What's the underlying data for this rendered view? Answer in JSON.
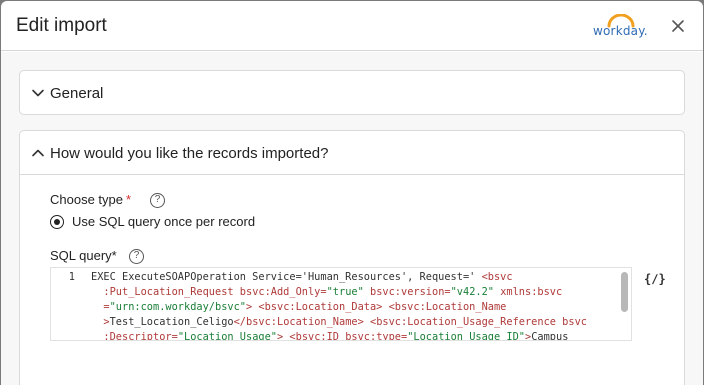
{
  "dialog": {
    "title": "Edit import",
    "logo_text": "workday.",
    "close_icon": "close-icon"
  },
  "sections": {
    "general": {
      "title": "General",
      "expanded": false
    },
    "records": {
      "title": "How would you like the records imported?",
      "expanded": true,
      "choose_type_label": "Choose type",
      "choose_type_required": "*",
      "radio_option": "Use SQL query once per record",
      "radio_selected": true,
      "sql_label": "SQL query",
      "sql_required": "*",
      "editor": {
        "line_number": "1",
        "lines": [
          [
            [
              "t",
              "EXEC ExecuteSOAPOperation Service='Human_Resources', Request=' "
            ],
            [
              "g",
              "<bsvc"
            ]
          ],
          [
            [
              "t",
              "  "
            ],
            [
              "g",
              ":Put_Location_Request bsvc:Add_Only="
            ],
            [
              "s",
              "\"true\""
            ],
            [
              "g",
              " bsvc:version="
            ],
            [
              "s",
              "\"v42.2\""
            ],
            [
              "g",
              " xmlns:bsvc"
            ]
          ],
          [
            [
              "t",
              "  "
            ],
            [
              "g",
              "="
            ],
            [
              "s",
              "\"urn:com.workday/bsvc\""
            ],
            [
              "g",
              "> <bsvc:Location_Data> <bsvc:Location_Name"
            ]
          ],
          [
            [
              "t",
              "  "
            ],
            [
              "g",
              ">"
            ],
            [
              "t",
              "Test_Location_Celigo"
            ],
            [
              "g",
              "</bsvc:Location_Name> <bsvc:Location_Usage_Reference bsvc"
            ]
          ],
          [
            [
              "t",
              "  "
            ],
            [
              "g",
              ":Descriptor="
            ],
            [
              "s",
              "\"Location Usage\""
            ],
            [
              "g",
              "> <bsvc:ID bsvc:type="
            ],
            [
              "s",
              "\"Location_Usage_ID\""
            ],
            [
              "g",
              ">"
            ],
            [
              "t",
              "Campus"
            ]
          ]
        ]
      },
      "formula_button": "{∕}"
    }
  },
  "colors": {
    "required": "#d32f2f",
    "logo_blue": "#2f6bb3",
    "logo_orange": "#f2a01f",
    "xml_tag": "#b03a3a",
    "xml_string": "#1a7f37"
  }
}
